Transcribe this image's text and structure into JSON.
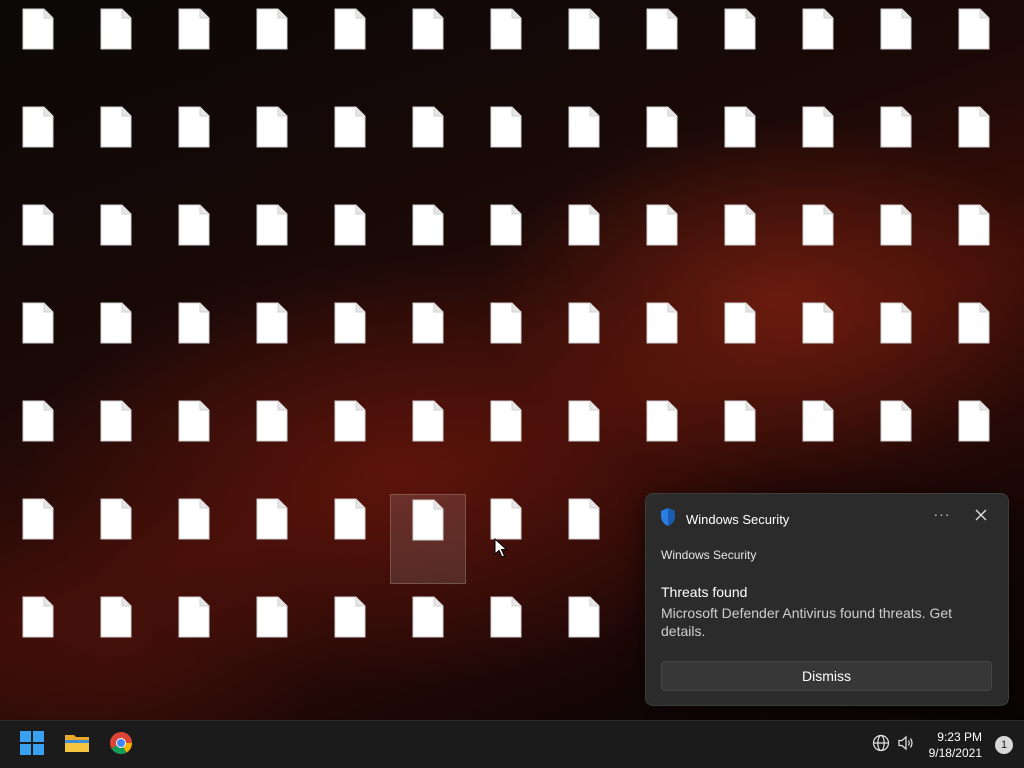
{
  "desktop": {
    "columns": 13,
    "rows": 7,
    "label_note": "",
    "selected_icon": {
      "row": 5,
      "col": 5
    },
    "items_per_row": [
      13,
      13,
      13,
      13,
      13,
      8,
      8
    ]
  },
  "toast": {
    "app_name": "Windows Security",
    "more_glyph": "···",
    "source": "Windows Security",
    "title": "Threats found",
    "body": "Microsoft Defender Antivirus found threats. Get details.",
    "dismiss_label": "Dismiss"
  },
  "taskbar": {
    "pinned": [
      {
        "name": "start-icon"
      },
      {
        "name": "file-explorer-icon"
      },
      {
        "name": "chrome-icon"
      }
    ],
    "tray": [
      "globe-icon",
      "speaker-icon"
    ],
    "time": "9:23 PM",
    "date": "9/18/2021",
    "notification_count": "1"
  },
  "colors": {
    "taskbar_bg": "#1b1b1b",
    "toast_bg": "#2b2b2b",
    "shield_blue": "#2a7de1"
  }
}
